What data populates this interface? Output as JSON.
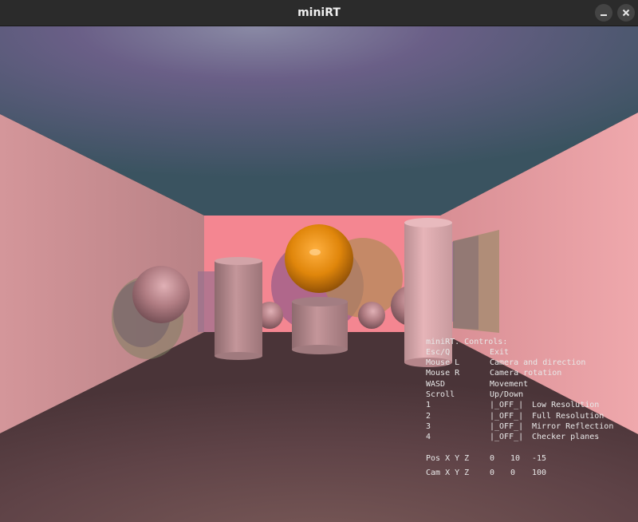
{
  "window": {
    "title": "miniRT"
  },
  "hud": {
    "heading": "miniRT. Controls:",
    "controls": [
      {
        "key": "Esc/Q",
        "action": "Exit"
      },
      {
        "key": "Mouse L",
        "action": "Camera and direction"
      },
      {
        "key": "Mouse R",
        "action": "Camera rotation"
      },
      {
        "key": "WASD",
        "action": "Movement"
      },
      {
        "key": "Scroll",
        "action": "Up/Down"
      }
    ],
    "toggles": [
      {
        "key": "1",
        "state": "|_OFF_|",
        "label": "Low Resolution"
      },
      {
        "key": "2",
        "state": "|_OFF_|",
        "label": "Full Resolution"
      },
      {
        "key": "3",
        "state": "|_OFF_|",
        "label": "Mirror Reflection"
      },
      {
        "key": "4",
        "state": "|_OFF_|",
        "label": "Checker planes"
      }
    ],
    "pos": {
      "label": "Pos X Y Z",
      "x": "0",
      "y": "10",
      "z": "-15"
    },
    "cam": {
      "label": "Cam X Y Z",
      "x": "0",
      "y": "0",
      "z": "100"
    }
  },
  "colors": {
    "sky": "#3b5560",
    "floor": "#5a3f45",
    "wall_left": "#cf8a8f",
    "wall_right": "#eba4a8",
    "back_wall": "#f48691",
    "orange_sphere": "#e0860b",
    "pink_sphere": "#b67f85",
    "cylinder": "#b5858a"
  }
}
